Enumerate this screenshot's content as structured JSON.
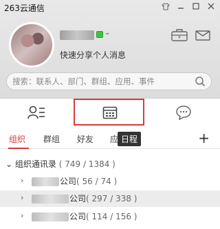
{
  "app": {
    "title": "263云通信"
  },
  "profile": {
    "signature": "快速分享个人消息"
  },
  "search": {
    "placeholder": "搜索：联系人、部门、群组、应用、事件"
  },
  "subtabs": {
    "items": [
      {
        "label": "组织"
      },
      {
        "label": "群组"
      },
      {
        "label": "好友"
      },
      {
        "label": "应"
      }
    ],
    "add": "+",
    "tooltip": "日程"
  },
  "directory": {
    "root": {
      "label": "组织通讯录",
      "count": "( 749 / 1384 )"
    },
    "companies": [
      {
        "name": "公司",
        "count": "( 56 / 74 )"
      },
      {
        "name": "公司",
        "count": "( 297 / 338 )"
      },
      {
        "name": "公司",
        "count": "( 114 / 156 )"
      }
    ]
  },
  "colors": {
    "accent": "#d43b3b",
    "status_online": "#3ec443"
  }
}
